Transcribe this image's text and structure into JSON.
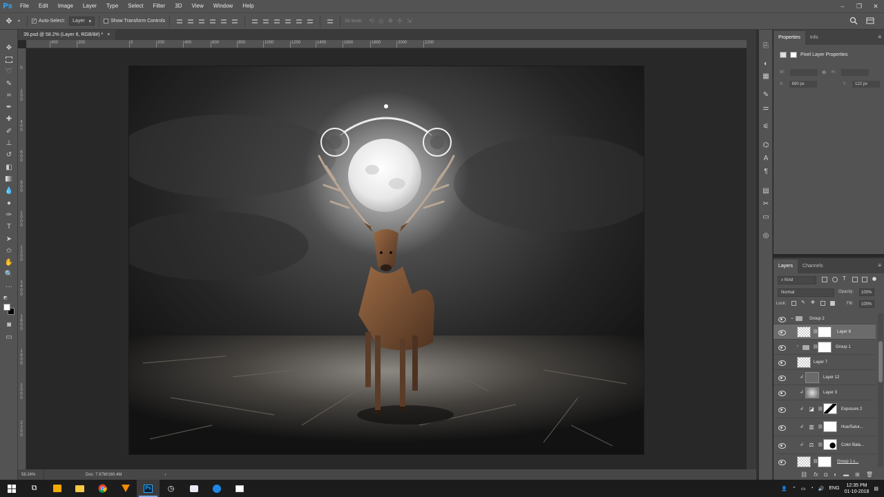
{
  "app": {
    "logo": "Ps",
    "menu": [
      "File",
      "Edit",
      "Image",
      "Layer",
      "Type",
      "Select",
      "Filter",
      "3D",
      "View",
      "Window",
      "Help"
    ],
    "window_controls": [
      "–",
      "❐",
      "✕"
    ]
  },
  "options": {
    "move_icon": "✥",
    "auto_select_label": "Auto-Select:",
    "auto_select_value": "Layer",
    "show_transform_label": "Show Transform Controls",
    "mode_label": "3D Mode:",
    "search_icon": "search-icon",
    "workspace_icon": "workspace-icon"
  },
  "document": {
    "tab_title": "39.psd @ 58.2% (Layer 6, RGB/8#) *",
    "close": "×",
    "zoom": "58.24%",
    "doc_size": "Doc: 7.97M/160.4M",
    "status_arrow": "›"
  },
  "rulers": {
    "top": [
      "400",
      "200",
      "0",
      "200",
      "400",
      "600",
      "800",
      "1000",
      "1200",
      "1400",
      "1600",
      "1800",
      "2000",
      "2200"
    ],
    "left": [
      "0",
      "2 0 0",
      "4 0 0",
      "6 0 0",
      "8 0 0",
      "1 0 0 0",
      "1 2 0 0",
      "1 4 0 0",
      "1 6 0 0",
      "1 8 0 0",
      "2 0 0 0",
      "2 2 0 0"
    ]
  },
  "properties": {
    "tabs": [
      "Properties",
      "Info"
    ],
    "title": "Pixel Layer Properties",
    "w_label": "W:",
    "h_label": "H:",
    "x_label": "X:",
    "x_value": "680 px",
    "y_label": "Y:",
    "y_value": "122 px",
    "w_value": "",
    "h_value": ""
  },
  "layers_panel": {
    "tabs": [
      "Layers",
      "Channels"
    ],
    "kind": "⌕ Kind",
    "blend_mode": "Normal",
    "opacity_label": "Opacity:",
    "opacity_value": "100%",
    "lock_label": "Lock:",
    "fill_label": "Fill:",
    "fill_value": "100%",
    "layers": [
      {
        "name": "Group 2",
        "type": "group"
      },
      {
        "name": "Layer 6",
        "type": "layer",
        "selected": true
      },
      {
        "name": "Group 1",
        "type": "group-nested"
      },
      {
        "name": "Layer 7",
        "type": "layer"
      },
      {
        "name": "Layer 12",
        "type": "clip"
      },
      {
        "name": "Layer 3",
        "type": "clip"
      },
      {
        "name": "Exposure 2",
        "type": "adjust"
      },
      {
        "name": "Hue/Satur...",
        "type": "adjust"
      },
      {
        "name": "Color Bala...",
        "type": "adjust"
      },
      {
        "name": "Group 1 c...",
        "type": "group"
      }
    ],
    "footer_icons": [
      "link-icon",
      "fx-icon",
      "mask-icon",
      "adjustment-icon",
      "folder-icon",
      "new-layer-icon",
      "trash-icon"
    ]
  },
  "taskbar": {
    "time": "12:35 PM",
    "date": "01-10-2018",
    "lang": "ENG"
  }
}
